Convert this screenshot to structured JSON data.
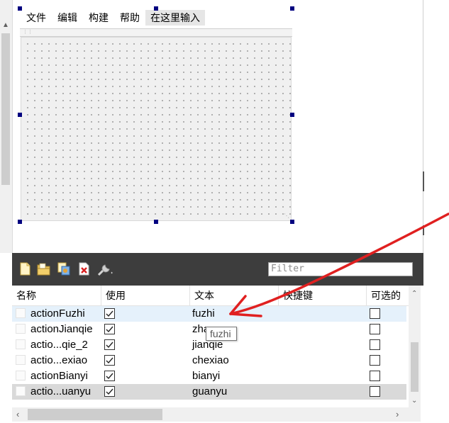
{
  "menubar": {
    "items": [
      "文件",
      "编辑",
      "构建",
      "帮助"
    ],
    "placeholder_item": "在这里输入"
  },
  "toolbar": {
    "icons": [
      "new-action-icon",
      "open-icon",
      "copy-icon",
      "delete-icon",
      "configure-icon"
    ],
    "filter_placeholder": "Filter"
  },
  "table": {
    "columns": [
      "名称",
      "使用",
      "文本",
      "快捷键",
      "可选的"
    ],
    "rows": [
      {
        "name": "actionFuzhi",
        "used": true,
        "text": "fuzhi",
        "shortcut": "",
        "checkable": false
      },
      {
        "name": "actionJianqie",
        "used": true,
        "text": "zha",
        "shortcut": "",
        "checkable": false
      },
      {
        "name": "actio...qie_2",
        "used": true,
        "text": "jianqie",
        "shortcut": "",
        "checkable": false
      },
      {
        "name": "actio...exiao",
        "used": true,
        "text": "chexiao",
        "shortcut": "",
        "checkable": false
      },
      {
        "name": "actionBianyi",
        "used": true,
        "text": "bianyi",
        "shortcut": "",
        "checkable": false
      },
      {
        "name": "actio...uanyu",
        "used": true,
        "text": "guanyu",
        "shortcut": "",
        "checkable": false
      }
    ]
  },
  "tooltip": {
    "text": "fuzhi"
  },
  "colors": {
    "toolbar_bg": "#3d3d3d",
    "selection_handle": "#000080",
    "selected_row": "#e5f1fb",
    "alt_row": "#d9d9d9",
    "annotation_arrow": "#e02020"
  }
}
